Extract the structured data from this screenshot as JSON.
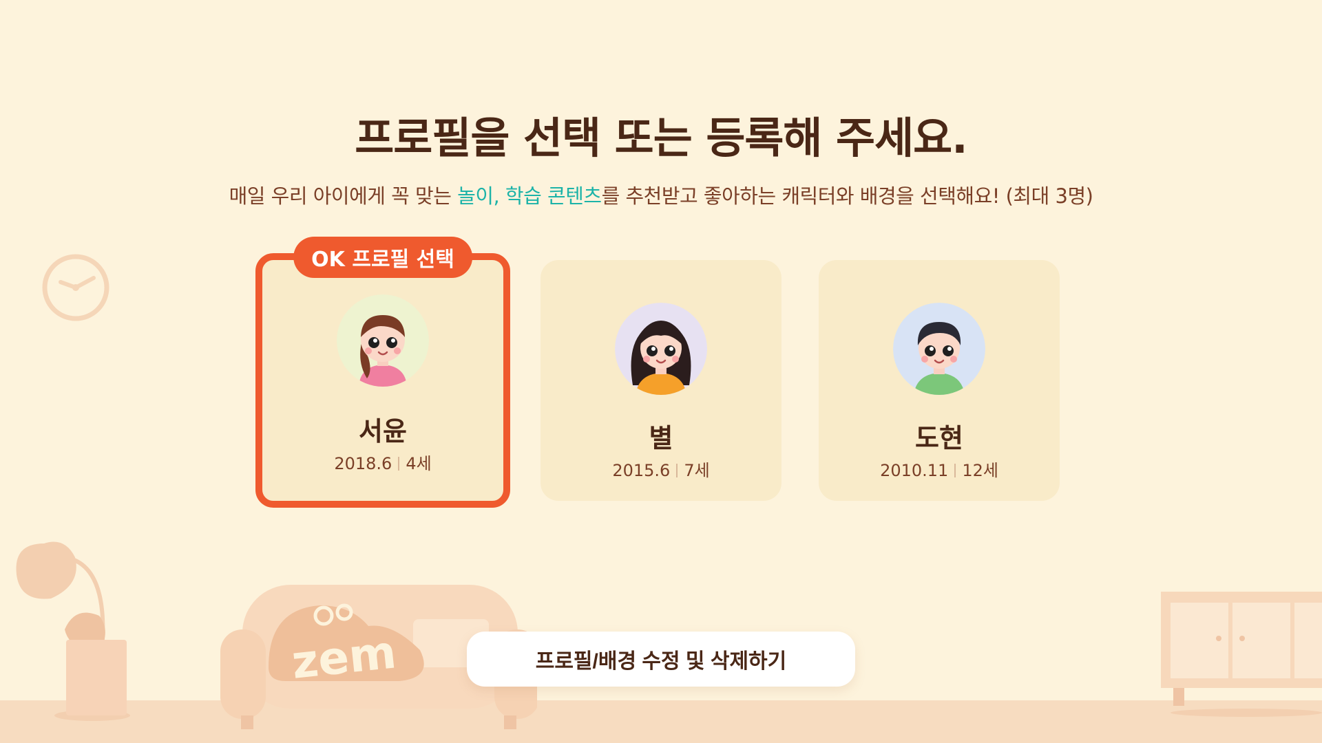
{
  "header": {
    "title": "프로필을 선택 또는 등록해 주세요.",
    "subtitle_prefix": "매일 우리 아이에게 꼭 맞는 ",
    "subtitle_highlight": "놀이, 학습 콘텐츠",
    "subtitle_suffix": "를 추천받고 좋아하는 캐릭터와 배경을 선택해요! (최대 3명)"
  },
  "profiles": [
    {
      "name": "서윤",
      "birth": "2018.6",
      "age": "4세",
      "selected": true,
      "avatar_icon": "girl-pigtail-avatar"
    },
    {
      "name": "별",
      "birth": "2015.6",
      "age": "7세",
      "selected": false,
      "avatar_icon": "girl-long-hair-avatar"
    },
    {
      "name": "도현",
      "birth": "2010.11",
      "age": "12세",
      "selected": false,
      "avatar_icon": "boy-avatar"
    }
  ],
  "badge": {
    "label": "OK 프로필 선택"
  },
  "edit_button": {
    "label": "프로필/배경 수정 및 삭제하기"
  },
  "logo": {
    "text": "zem"
  },
  "colors": {
    "background": "#fdf3dc",
    "accent": "#ef5a2e",
    "highlight": "#1cb3a8",
    "title": "#4a2716",
    "card": "#f9ebc9"
  }
}
